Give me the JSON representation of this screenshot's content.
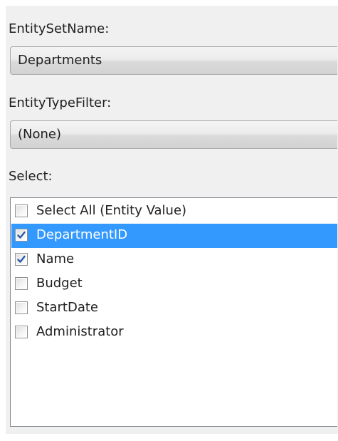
{
  "entity_set": {
    "label": "EntitySetName:",
    "value": "Departments"
  },
  "entity_type_filter": {
    "label": "EntityTypeFilter:",
    "value": "(None)"
  },
  "select": {
    "label": "Select:",
    "items": [
      {
        "label": "Select All (Entity Value)",
        "checked": false,
        "selected": false
      },
      {
        "label": "DepartmentID",
        "checked": true,
        "selected": true
      },
      {
        "label": "Name",
        "checked": true,
        "selected": false
      },
      {
        "label": "Budget",
        "checked": false,
        "selected": false
      },
      {
        "label": "StartDate",
        "checked": false,
        "selected": false
      },
      {
        "label": "Administrator",
        "checked": false,
        "selected": false
      }
    ]
  },
  "colors": {
    "selection": "#3399ff",
    "panel_background": "#f0f0f0",
    "check_mark": "#2a5aa8"
  }
}
